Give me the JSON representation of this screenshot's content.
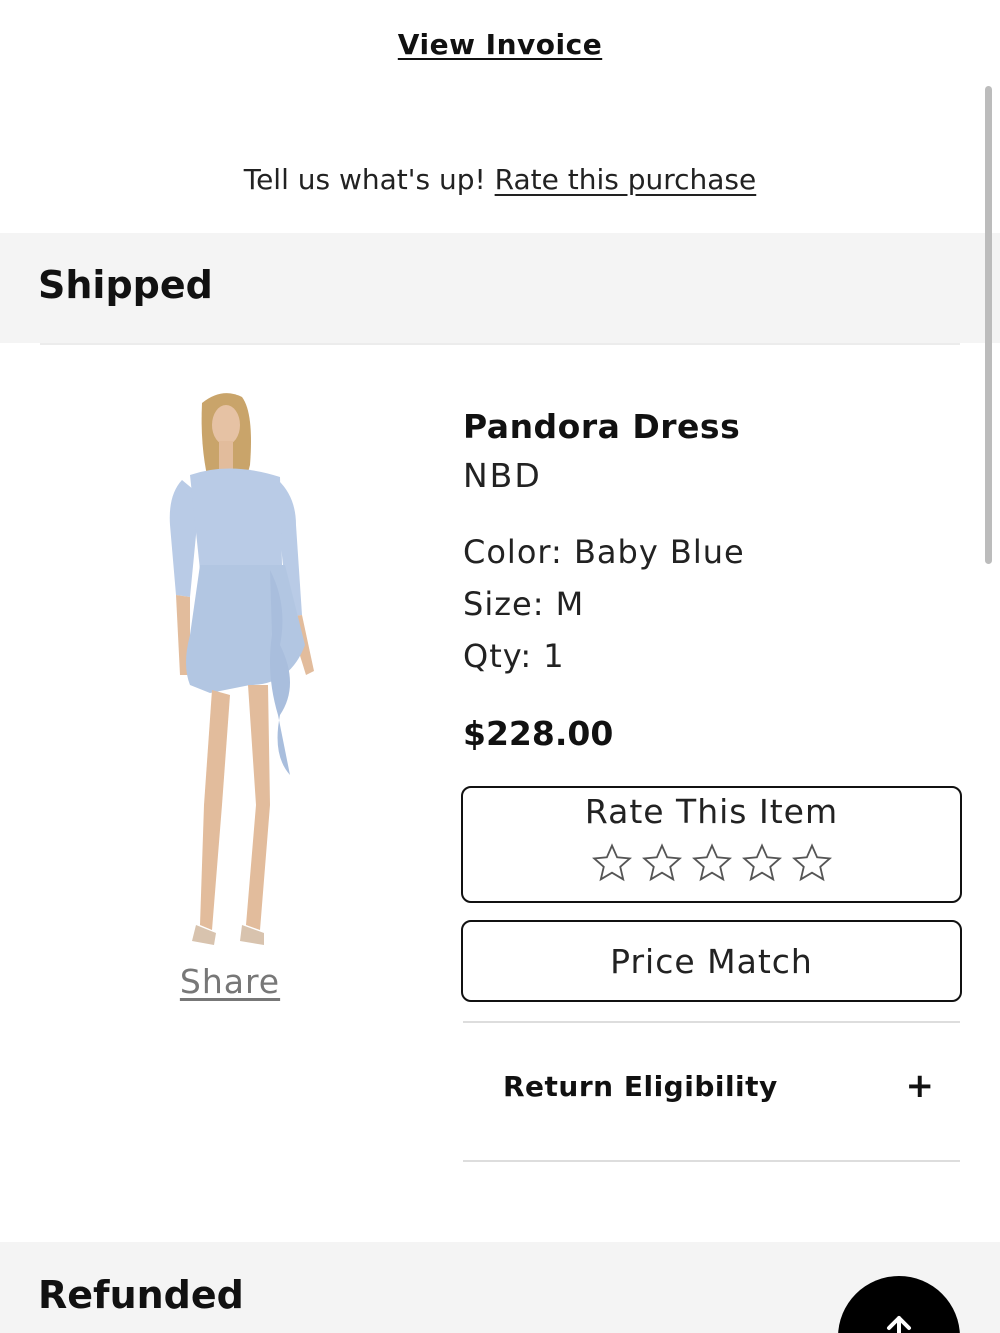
{
  "header": {
    "view_invoice": "View Invoice",
    "rate_prompt": "Tell us what's up!",
    "rate_link": "Rate this purchase"
  },
  "sections": {
    "shipped": "Shipped",
    "refunded": "Refunded"
  },
  "product": {
    "name": "Pandora Dress",
    "brand": "NBD",
    "color": "Color: Baby Blue",
    "size": "Size: M",
    "qty": "Qty: 1",
    "price": "$228.00",
    "image_icon": "dress-photo",
    "dress_color": "#b9cbe6"
  },
  "actions": {
    "share": "Share",
    "rate_item": "Rate This Item",
    "rating": 0,
    "max_rating": 5,
    "price_match": "Price Match",
    "return_eligibility": "Return Eligibility",
    "expand_symbol": "+"
  },
  "colors": {
    "band": "#f4f4f4",
    "text": "#111111",
    "fab": "#000000"
  }
}
